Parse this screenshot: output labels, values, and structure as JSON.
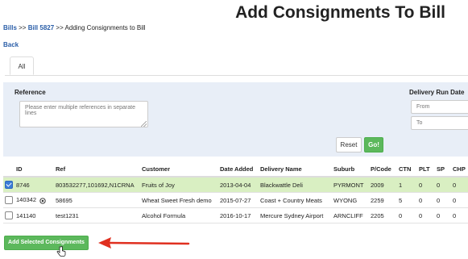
{
  "page": {
    "title": "Add Consignments To Bill",
    "breadcrumb": {
      "bills": "Bills",
      "sep1": " >> ",
      "bill": "Bill 5827",
      "sep2": " >> ",
      "current": "Adding Consignments to Bill"
    },
    "back_label": "Back"
  },
  "tabs": [
    {
      "label": "All",
      "active": true
    }
  ],
  "filters": {
    "reference_label": "Reference",
    "reference_placeholder": "Please enter multiple references in separate lines",
    "delivery_run_date_label": "Delivery Run Date",
    "from_placeholder": "From",
    "to_placeholder": "To",
    "reset_label": "Reset",
    "go_label": "Go!"
  },
  "table": {
    "columns": [
      "",
      "ID",
      "Ref",
      "Customer",
      "Date Added",
      "Delivery Name",
      "Suburb",
      "P/Code",
      "CTN",
      "PLT",
      "SP",
      "CHP"
    ],
    "rows": [
      {
        "checked": true,
        "id": "8746",
        "has_icon": false,
        "ref": "803532277,101692,N1CRNA",
        "customer": "Fruits of Joy",
        "date_added": "2013-04-04",
        "delivery_name": "Blackwattle Deli",
        "suburb": "PYRMONT",
        "pcode": "2009",
        "ctn": "1",
        "plt": "0",
        "sp": "0",
        "chp": "0"
      },
      {
        "checked": false,
        "id": "140342",
        "has_icon": true,
        "ref": "58695",
        "customer": "Wheat Sweet Fresh demo",
        "date_added": "2015-07-27",
        "delivery_name": "Coast + Country Meats",
        "suburb": "WYONG",
        "pcode": "2259",
        "ctn": "5",
        "plt": "0",
        "sp": "0",
        "chp": "0"
      },
      {
        "checked": false,
        "id": "141140",
        "has_icon": false,
        "ref": "test1231",
        "customer": "Alcohol Formula",
        "date_added": "2016-10-17",
        "delivery_name": "Mercure Sydney Airport",
        "suburb": "ARNCLIFF",
        "pcode": "2205",
        "ctn": "0",
        "plt": "0",
        "sp": "0",
        "chp": "0"
      }
    ]
  },
  "actions": {
    "add_selected_label": "Add Selected Consignments"
  },
  "colors": {
    "accent_green": "#5cb85c",
    "link_blue": "#2a5ea8",
    "selected_row": "#d9efc2",
    "filter_panel": "#e8eef7",
    "arrow_red": "#e03020"
  },
  "icons": {
    "row_icon": "eye-icon",
    "pointer": "hand-cursor-icon",
    "annotation": "red-arrow-icon"
  }
}
